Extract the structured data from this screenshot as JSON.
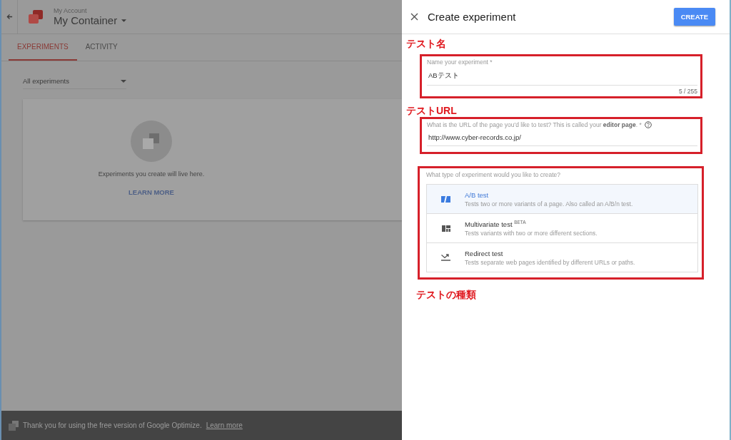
{
  "background": {
    "account": "My Account",
    "container": "My Container",
    "tabs": [
      {
        "label": "EXPERIMENTS",
        "selected": true
      },
      {
        "label": "ACTIVITY",
        "selected": false
      }
    ],
    "filter": {
      "value": "All experiments"
    },
    "empty_state": {
      "message": "Experiments you create will live here.",
      "link": "LEARN MORE"
    },
    "footer": {
      "message": "Thank you for using the free version of Google Optimize.",
      "link": "Learn more"
    }
  },
  "panel": {
    "title": "Create experiment",
    "create_button": "CREATE",
    "name_field": {
      "annotation": "テスト名",
      "label": "Name your experiment *",
      "value": "ABテスト",
      "counter": "5 / 255"
    },
    "url_field": {
      "annotation": "テストURL",
      "label": "What is the URL of the page you'd like to test? This is called your **editor page**. *",
      "value": "http://www.cyber-records.co.jp/"
    },
    "type_section": {
      "question": "What type of experiment would you like to create?",
      "annotation": "テストの種類",
      "options": [
        {
          "kind": "ab",
          "title": "A/B test",
          "description": "Tests two or more variants of a page. Also called an A/B/n test.",
          "selected": true
        },
        {
          "kind": "multivariate",
          "title": "Multivariate test",
          "badge": "BETA",
          "description": "Tests variants with two or more different sections.",
          "selected": false
        },
        {
          "kind": "redirect",
          "title": "Redirect test",
          "description": "Tests separate web pages identified by different URLs or paths.",
          "selected": false
        }
      ]
    }
  }
}
